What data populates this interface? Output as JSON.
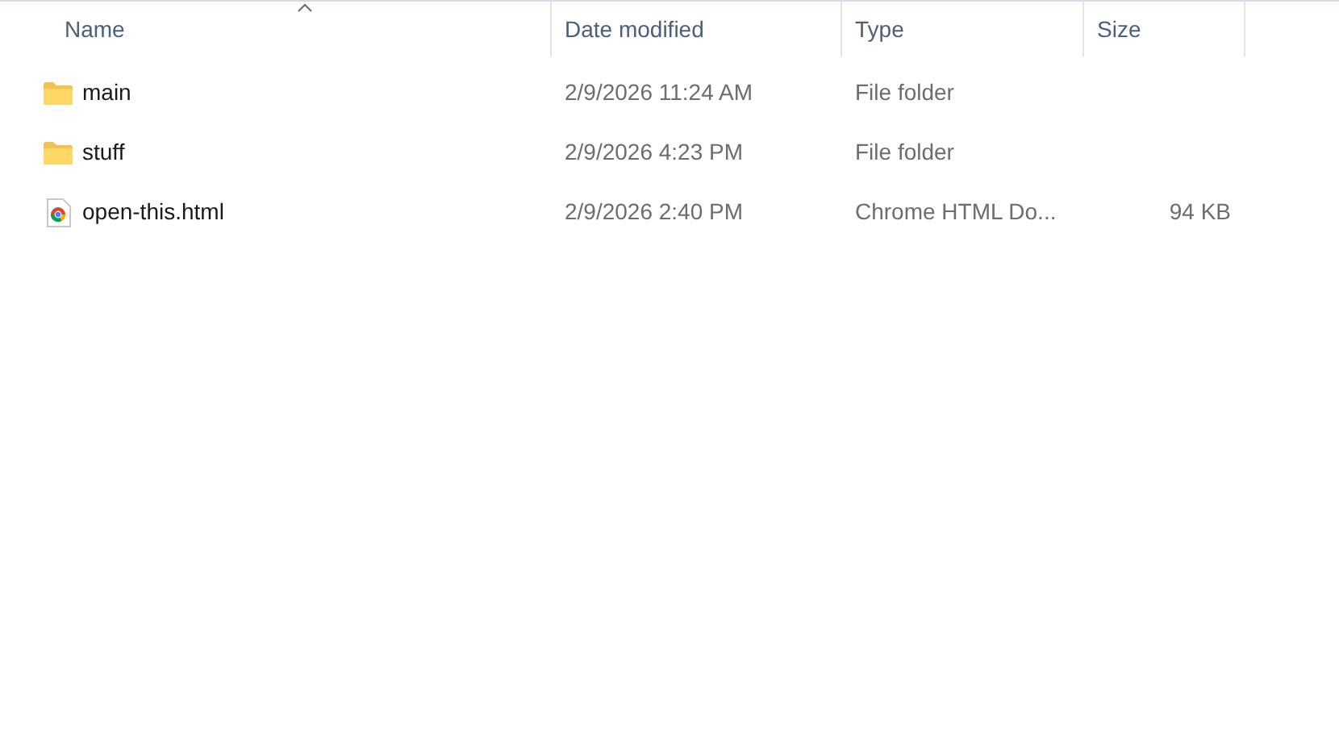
{
  "columns": [
    {
      "label": "Name",
      "sorted": true
    },
    {
      "label": "Date modified",
      "sorted": false
    },
    {
      "label": "Type",
      "sorted": false
    },
    {
      "label": "Size",
      "sorted": false
    }
  ],
  "rows": [
    {
      "kind": "folder",
      "name": "main",
      "date": "2/9/2026 11:24 AM",
      "type": "File folder"
    },
    {
      "kind": "folder",
      "name": "stuff",
      "date": "2/9/2026 4:23 PM",
      "type": "File folder"
    },
    {
      "kind": "html",
      "name": "open-this.html",
      "date": "2/9/2026 2:40 PM",
      "type": "Chrome HTML Do...",
      "size": "94 KB"
    }
  ]
}
